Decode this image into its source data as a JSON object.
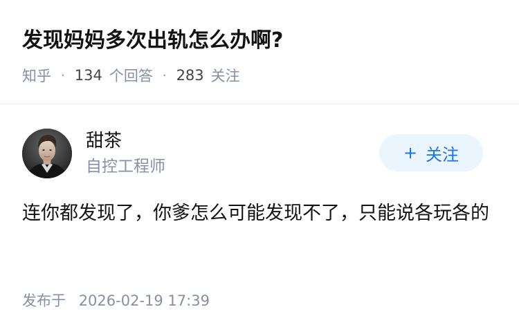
{
  "question": {
    "title": "发现妈妈多次出轨怎么办啊?",
    "source": "知乎",
    "answer_count": "134",
    "answer_label": "个回答",
    "follower_count": "283",
    "follower_label": "关注",
    "separator": "·"
  },
  "answer": {
    "author": {
      "name": "甜茶",
      "headline": "自控工程师",
      "avatar_icon": "user-avatar-photo"
    },
    "follow_button": {
      "icon": "+",
      "label": "关注"
    },
    "content": "连你都发现了，你爹怎么可能发现不了，只能说各玩各的",
    "published_label": "发布于",
    "published_time": "2026-02-19 17:39"
  },
  "colors": {
    "primary_text": "#121212",
    "meta_text": "#8590a6",
    "accent_blue": "#1772f6",
    "follow_bg": "#ebf5fd",
    "divider": "#ebebeb"
  }
}
